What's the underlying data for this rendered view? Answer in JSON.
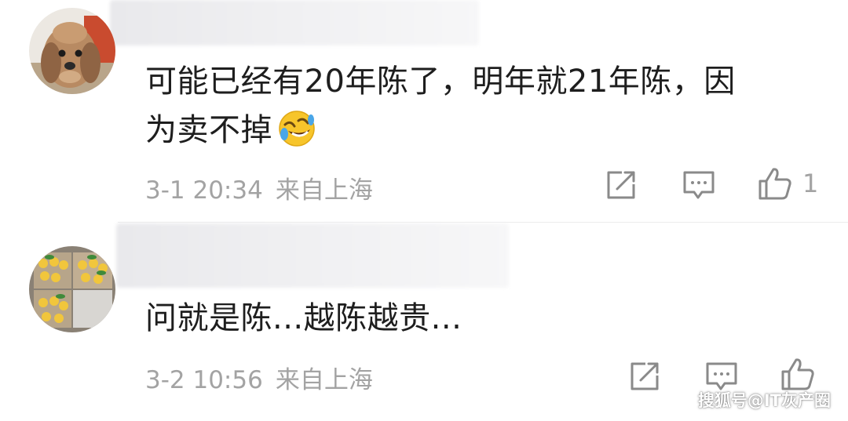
{
  "comments": [
    {
      "text_line1": "可能已经有20年陈了，明年就21年陈，因",
      "text_line2": "为卖不掉",
      "emoji": "rofl-emoji",
      "date": "3-1 20:34",
      "location": "来自上海",
      "likes": "1"
    },
    {
      "text_line1": "问就是陈...越陈越贵...",
      "date": "3-2 10:56",
      "location": "来自上海"
    }
  ],
  "icons": {
    "share": "share-icon",
    "reply": "reply-icon",
    "like": "thumbs-up-icon"
  },
  "colors": {
    "text": "#1e1e1e",
    "meta": "#a3a3a3",
    "icon": "#8a8a8a"
  },
  "watermark": "搜狐号@IT灰产圈"
}
